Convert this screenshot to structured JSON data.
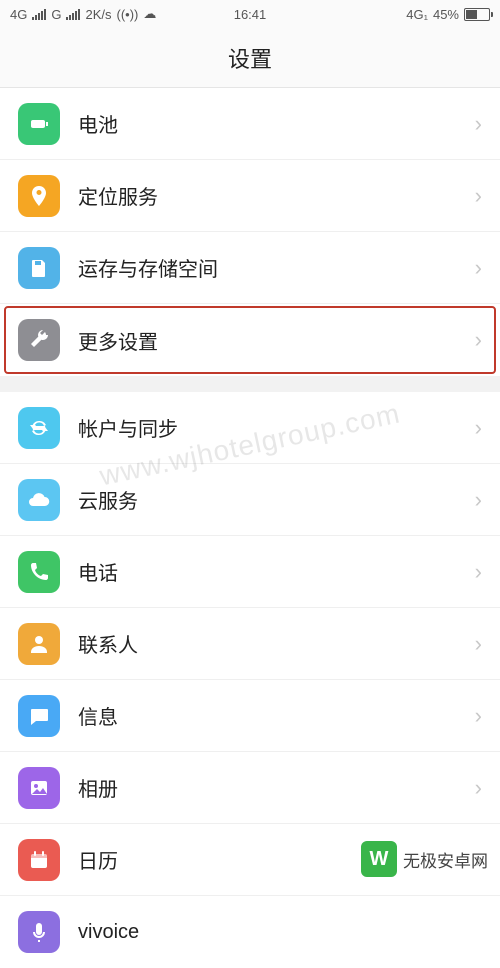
{
  "status": {
    "net1": "4G",
    "net2": "G",
    "speed": "2K/s",
    "time": "16:41",
    "net_right": "4G₁",
    "battery_pct": "45%"
  },
  "header": {
    "title": "设置"
  },
  "groups": [
    {
      "items": [
        {
          "key": "battery",
          "label": "电池",
          "icon": "battery-icon",
          "color": "#39c776"
        },
        {
          "key": "location",
          "label": "定位服务",
          "icon": "location-icon",
          "color": "#f5a623"
        },
        {
          "key": "storage",
          "label": "运存与存储空间",
          "icon": "storage-icon",
          "color": "#52b3e8"
        },
        {
          "key": "more",
          "label": "更多设置",
          "icon": "wrench-icon",
          "color": "#8e8e93",
          "highlight": true
        }
      ]
    },
    {
      "items": [
        {
          "key": "account",
          "label": "帐户与同步",
          "icon": "sync-icon",
          "color": "#4ec8ef"
        },
        {
          "key": "cloud",
          "label": "云服务",
          "icon": "cloud-icon",
          "color": "#5cc6f2"
        },
        {
          "key": "phone",
          "label": "电话",
          "icon": "phone-icon",
          "color": "#3fc566"
        },
        {
          "key": "contacts",
          "label": "联系人",
          "icon": "person-icon",
          "color": "#f0a93a"
        },
        {
          "key": "messages",
          "label": "信息",
          "icon": "message-icon",
          "color": "#49a9f5"
        },
        {
          "key": "gallery",
          "label": "相册",
          "icon": "photo-icon",
          "color": "#9d66e8"
        },
        {
          "key": "calendar",
          "label": "日历",
          "icon": "calendar-icon",
          "color": "#ea5b52"
        },
        {
          "key": "vivoice",
          "label": "vivoice",
          "icon": "mic-icon",
          "color": "#8c6fe0"
        }
      ]
    }
  ],
  "watermark": {
    "text": "无极安卓网",
    "url": "www.wjhotelgroup.com"
  }
}
